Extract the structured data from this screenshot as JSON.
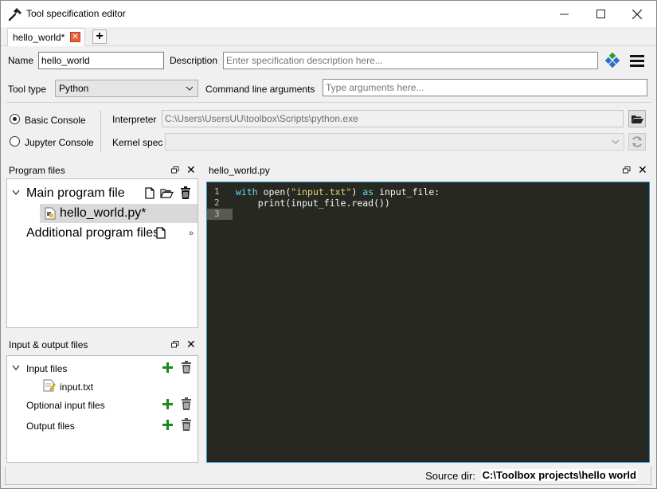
{
  "window": {
    "title": "Tool specification editor"
  },
  "tabs": [
    {
      "label": "hello_world*"
    }
  ],
  "spec": {
    "name_label": "Name",
    "name_value": "hello_world",
    "description_label": "Description",
    "description_placeholder": "Enter specification description here...",
    "tool_type_label": "Tool type",
    "tool_type_value": "Python",
    "cmdline_label": "Command line arguments",
    "cmdline_placeholder": "Type arguments here..."
  },
  "console": {
    "basic_label": "Basic Console",
    "jupyter_label": "Jupyter Console",
    "selected": "Basic Console",
    "interpreter_label": "Interpreter",
    "interpreter_value": "C:\\Users\\UsersUU\\toolbox\\Scripts\\python.exe",
    "kernel_label": "Kernel spec",
    "kernel_value": ""
  },
  "program_files": {
    "title": "Program files",
    "main_label": "Main program file",
    "main_file": "hello_world.py*",
    "additional_label": "Additional program files"
  },
  "io_files": {
    "title": "Input & output files",
    "input_label": "Input files",
    "input_file": "input.txt",
    "optional_label": "Optional input files",
    "output_label": "Output files"
  },
  "editor": {
    "title": "hello_world.py",
    "line_numbers": [
      "1",
      "2",
      "3"
    ],
    "lines": [
      [
        {
          "t": "with",
          "c": "kw"
        },
        {
          "t": " open(",
          "c": ""
        },
        {
          "t": "\"input.txt\"",
          "c": "str"
        },
        {
          "t": ") ",
          "c": ""
        },
        {
          "t": "as",
          "c": "kw"
        },
        {
          "t": " input_file:",
          "c": ""
        }
      ],
      [
        {
          "t": "    print(input_file.read())",
          "c": ""
        }
      ],
      []
    ]
  },
  "status": {
    "source_label": "Source dir:",
    "source_value": "C:\\Toolbox projects\\hello world"
  },
  "colors": {
    "editor_bg": "#272822",
    "keyword": "#66d9ef",
    "string": "#e6db74",
    "add_green": "#1a8a1a",
    "accent_border": "#2f95c8"
  }
}
